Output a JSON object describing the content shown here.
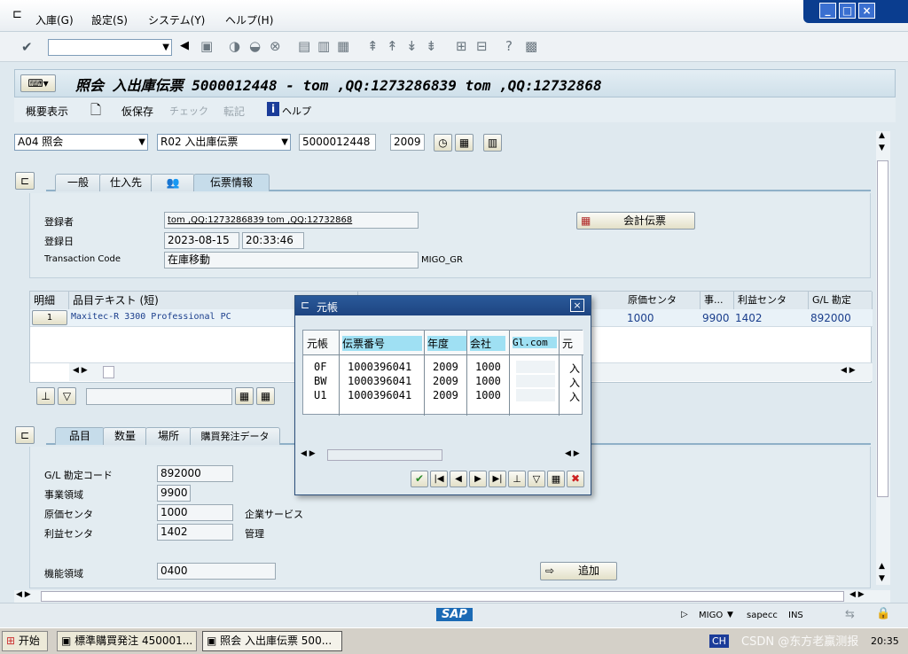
{
  "menu": {
    "items": [
      "入庫(G)",
      "設定(S)",
      "システム(Y)",
      "ヘルプ(H)"
    ]
  },
  "window": {
    "minimize": "_",
    "maximize": "□",
    "close": "×"
  },
  "title": {
    "text": "照会 入出庫伝票 5000012448 - tom ,QQ:1273286839 tom ,QQ:12732868"
  },
  "app_toolbar": {
    "overview": "概要表示",
    "hold": "仮保存",
    "check": "チェック",
    "post": "転記",
    "help": "ヘルプ"
  },
  "header": {
    "action": "A04 照会",
    "ref_doc": "R02 入出庫伝票",
    "doc_number": "5000012448",
    "year": "2009"
  },
  "header_tabs": [
    "一般",
    "仕入先",
    "伝票情報"
  ],
  "doc_info": {
    "creator_label": "登録者",
    "creator_value": "tom ,QQ:1273286839 tom ,QQ:12732868",
    "date_label": "登録日",
    "date_value": "2023-08-15",
    "time_value": "20:33:46",
    "tcode_label": "Transaction Code",
    "tcode_value": "在庫移動",
    "tcode_code": "MIGO_GR",
    "acct_button": "会計伝票"
  },
  "item_grid": {
    "col_detail": "明細",
    "col_text": "品目テキスト (短)",
    "col_cost": "原価センタ",
    "col_busarea": "事...",
    "col_profit": "利益センタ",
    "col_gl": "G/L 勘定",
    "row1": {
      "line": "1",
      "text": "Maxitec-R 3300 Professional PC",
      "cost": "1000",
      "busarea": "9900",
      "profit": "1402",
      "gl": "892000"
    }
  },
  "detail_tabs": [
    "品目",
    "数量",
    "場所",
    "購買発注データ"
  ],
  "detail": {
    "gl_label": "G/L 勘定コード",
    "gl_value": "892000",
    "ba_label": "事業領域",
    "ba_value": "9900",
    "cc_label": "原価センタ",
    "cc_value": "1000",
    "cc_text": "企業サービス",
    "pc_label": "利益センタ",
    "pc_value": "1402",
    "pc_text": "管理",
    "fa_label": "機能領域",
    "fa_value": "0400",
    "add_button": "追加"
  },
  "popup": {
    "title": "元帳",
    "headers": [
      "元帳",
      "伝票番号",
      "年度",
      "会社",
      "Gl.com",
      "元"
    ],
    "rows": [
      {
        "ledger": "0F",
        "doc": "1000396041",
        "year": "2009",
        "company": "1000",
        "glcom": "",
        "src": "入"
      },
      {
        "ledger": "BW",
        "doc": "1000396041",
        "year": "2009",
        "company": "1000",
        "glcom": "",
        "src": "入"
      },
      {
        "ledger": "U1",
        "doc": "1000396041",
        "year": "2009",
        "company": "1000",
        "glcom": "",
        "src": "入"
      }
    ]
  },
  "status_bar": {
    "sap": "SAP",
    "tcode": "MIGO",
    "server": "sapecc",
    "mode": "INS"
  },
  "taskbar": {
    "start": "开始",
    "task1": "標準購買発注 450001...",
    "task2": "照会 入出庫伝票 500...",
    "lang": "CH",
    "watermark": "CSDN @东方老赢测报",
    "clock": "20:35"
  },
  "colors": {
    "accent": "#c6dcea",
    "titlebar": "#0a3d8f",
    "link": "#1a3e8c"
  }
}
